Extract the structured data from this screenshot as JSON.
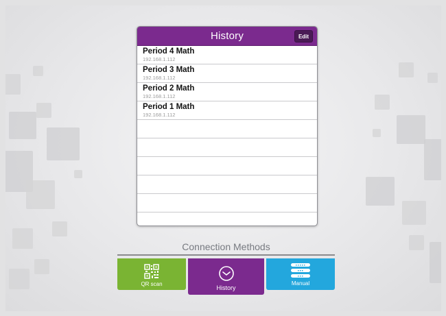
{
  "history_panel": {
    "title": "History",
    "edit_label": "Edit",
    "entries": [
      {
        "name": "Period 4 Math",
        "ip": "192.168.1.112"
      },
      {
        "name": "Period 3 Math",
        "ip": "192.168.1.112"
      },
      {
        "name": "Period 2 Math",
        "ip": "192.168.1.112"
      },
      {
        "name": "Period 1 Math",
        "ip": "192.168.1.112"
      }
    ]
  },
  "connection_methods": {
    "label": "Connection Methods",
    "tabs": [
      {
        "label": "QR scan",
        "icon": "qr-code-icon",
        "color": "#7ab433"
      },
      {
        "label": "History",
        "icon": "clock-icon",
        "color": "#7b2a8e",
        "selected": true
      },
      {
        "label": "Manual",
        "icon": "keyboard-icon",
        "color": "#23a7dd"
      }
    ]
  },
  "colors": {
    "accent_purple": "#7b2a8e",
    "green": "#7ab433",
    "blue": "#23a7dd"
  }
}
